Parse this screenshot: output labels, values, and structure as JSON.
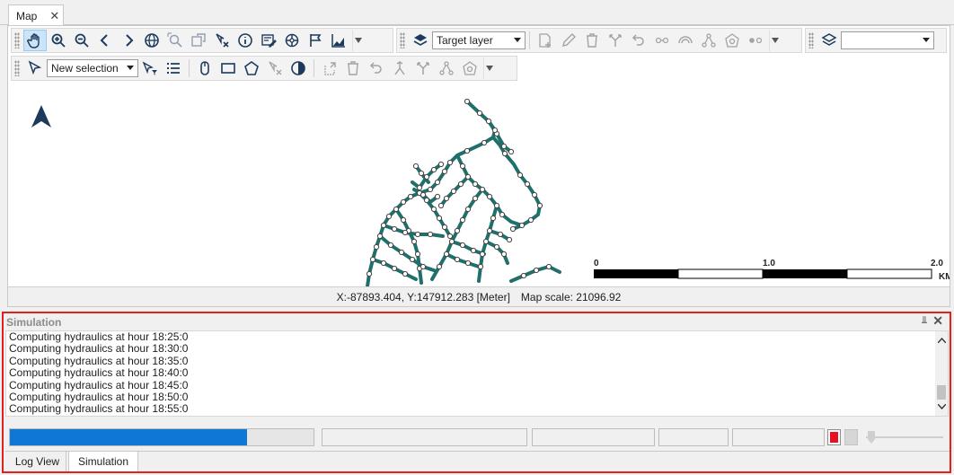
{
  "tabs": {
    "map_tab_label": "Map",
    "close_glyph": "✕"
  },
  "toolbar1": {
    "icons": [
      "pan-hand-icon",
      "zoom-in-icon",
      "zoom-out-icon",
      "back-icon",
      "forward-icon",
      "globe-icon",
      "zoom-window-icon",
      "zoom-pan-icon",
      "clear-selection-icon",
      "info-icon",
      "edit-attributes-icon",
      "network-icon",
      "flag-icon",
      "chart-icon"
    ],
    "target_layer_value": "Target layer",
    "edit_icons": [
      "add-node-icon",
      "pencil-icon",
      "delete-icon",
      "split-icon",
      "undo-icon",
      "vertex-icon",
      "arc-icon",
      "network-nodes-icon",
      "polygon-node-icon",
      "dots-icon"
    ],
    "layer_combo_value": ""
  },
  "toolbar2": {
    "selection_value": "New selection",
    "icons": [
      "select-arrow-icon",
      "filter-select-icon",
      "list-icon",
      "mouse-icon",
      "rectangle-select-icon",
      "pentagon-select-icon",
      "clear-select-icon",
      "contrast-icon",
      "rotate-icon",
      "delete-icon",
      "undo-icon",
      "merge-icon",
      "split-icon",
      "network-nodes-icon",
      "polygon-node-icon"
    ]
  },
  "map": {
    "network_color": "#1f6f6a",
    "scalebar": {
      "labels": [
        "0",
        "1.0",
        "2.0"
      ],
      "unit": "KM"
    }
  },
  "status": {
    "coords": "X:-87893.404, Y:147912.283 [Meter]",
    "scale": "Map scale: 21096.92"
  },
  "simulation": {
    "title": "Simulation",
    "pin_glyph": "📌",
    "close_glyph": "✕",
    "log_lines": [
      "Computing hydraulics  at hour  18:25:0",
      "Computing hydraulics  at hour  18:30:0",
      "Computing hydraulics  at hour  18:35:0",
      "Computing hydraulics  at hour  18:40:0",
      "Computing hydraulics  at hour  18:45:0",
      "Computing hydraulics  at hour  18:50:0",
      "Computing hydraulics  at hour  18:55:0"
    ],
    "progress_percent": 78,
    "progress_color": "#0f78d7",
    "stop_color": "#e81123"
  },
  "bottom_tabs": {
    "log_view": "Log View",
    "simulation": "Simulation"
  }
}
